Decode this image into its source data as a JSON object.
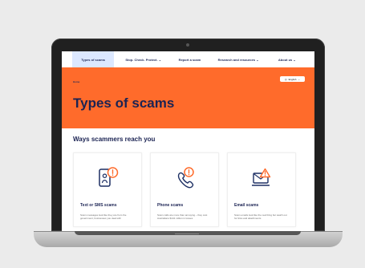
{
  "nav": {
    "items": [
      {
        "label": "Types of scams",
        "active": true
      },
      {
        "label": "Stop. Check. Protect. ⌄",
        "active": false
      },
      {
        "label": "Report a scam",
        "active": false
      },
      {
        "label": "Research and resources ⌄",
        "active": false
      },
      {
        "label": "About us ⌄",
        "active": false
      }
    ]
  },
  "hero": {
    "breadcrumb": "Home",
    "language_label": "English",
    "title": "Types of scams",
    "background_color": "#ff6b2b",
    "title_color": "#1b2353"
  },
  "section": {
    "title": "Ways scammers reach you"
  },
  "cards": [
    {
      "title": "Text or SMS scams",
      "description": "Scam messages look like they are from the government, businesses you deal with",
      "icon": "text-message-scam-icon"
    },
    {
      "title": "Phone scams",
      "description": "Scam calls are more than annoying – they cost Australians $141 million in losses",
      "icon": "phone-scam-icon"
    },
    {
      "title": "Email scams",
      "description": "Scam emails look like the real thing but watch out for links and attachments",
      "icon": "email-scam-icon"
    }
  ],
  "device": {
    "frame_color": "#202020",
    "base_color": "#bdbdbd"
  }
}
